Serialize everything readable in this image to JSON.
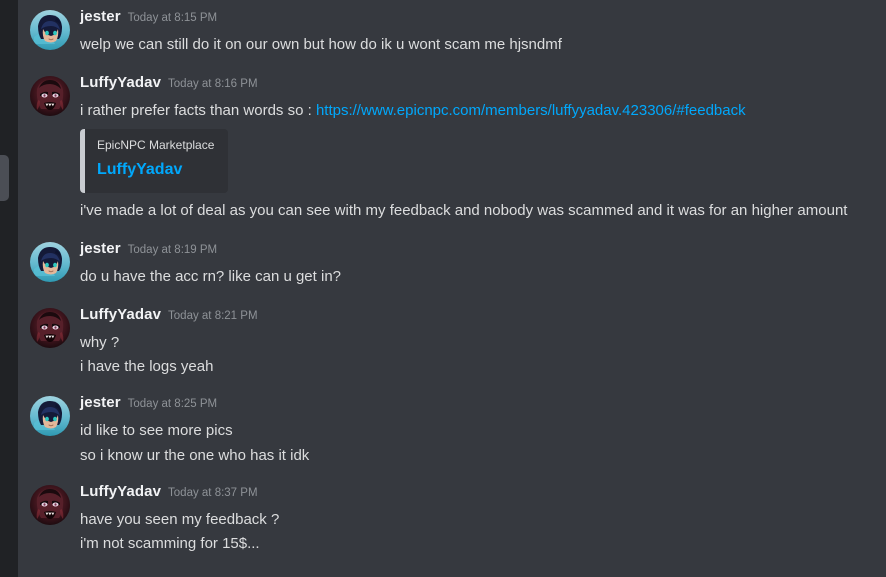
{
  "app": {
    "name": "discord-chat",
    "background_color": "#36393f",
    "rail_color": "#202225",
    "link_color": "#00a8fc",
    "text_color": "#dcddde",
    "username_color": "#f2f3f5",
    "timestamp_color": "#8e9297"
  },
  "messages": [
    {
      "author": "jester",
      "timestamp": "Today at 8:15 PM",
      "avatar": "jester-avatar",
      "lines": [
        "welp we can still do it on our own but how do ik u wont scam me hjsndmf"
      ]
    },
    {
      "author": "LuffyYadav",
      "timestamp": "Today at 8:16 PM",
      "avatar": "luffyyadav-avatar",
      "line_prefix": "i rather prefer facts than words so : ",
      "link_text": "https://www.epicnpc.com/members/luffyyadav.423306/#feedback",
      "embed": {
        "provider": "EpicNPC Marketplace",
        "title": "LuffyYadav",
        "accent_color": "#c9ccd1"
      },
      "lines": [
        "i've made a lot of deal as you can see with my feedback and nobody was scammed and it was for an higher amount"
      ]
    },
    {
      "author": "jester",
      "timestamp": "Today at 8:19 PM",
      "avatar": "jester-avatar",
      "lines": [
        "do u have the acc rn? like can u get in?"
      ]
    },
    {
      "author": "LuffyYadav",
      "timestamp": "Today at 8:21 PM",
      "avatar": "luffyyadav-avatar",
      "lines": [
        "why ?",
        "i have the logs yeah"
      ]
    },
    {
      "author": "jester",
      "timestamp": "Today at 8:25 PM",
      "avatar": "jester-avatar",
      "lines": [
        "id like to see more pics",
        "so i know ur the one who has it idk"
      ]
    },
    {
      "author": "LuffyYadav",
      "timestamp": "Today at 8:37 PM",
      "avatar": "luffyyadav-avatar",
      "lines": [
        "have you seen my feedback ?",
        "i'm not scamming for 15$..."
      ]
    }
  ]
}
